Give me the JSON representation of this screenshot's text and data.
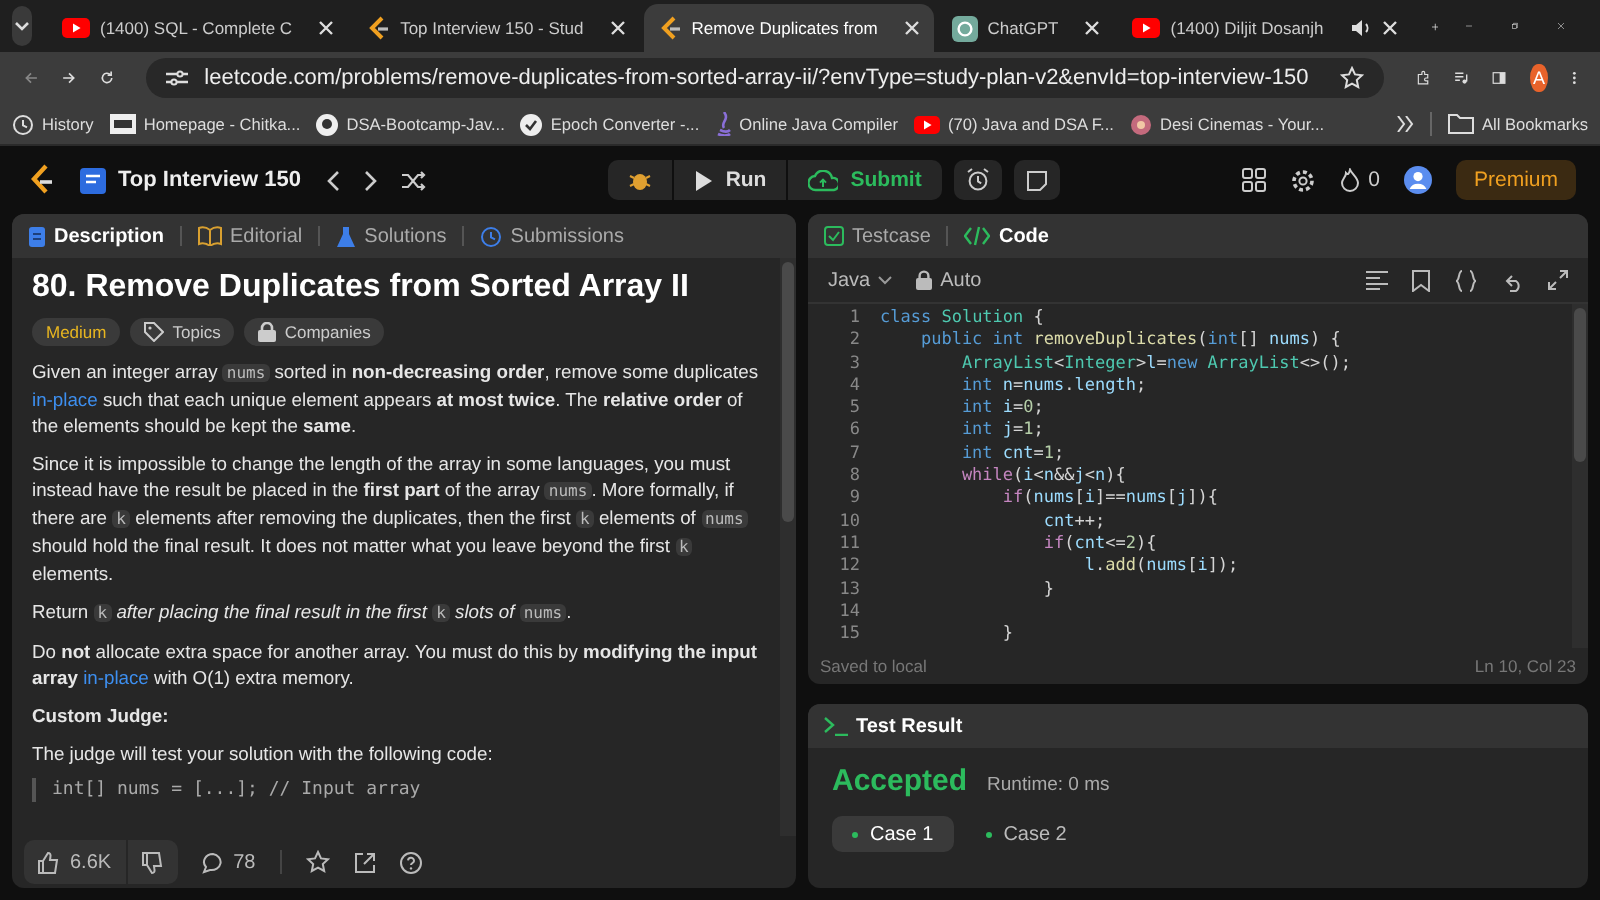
{
  "browser": {
    "tabs": [
      {
        "title": "(1400) SQL - Complete C",
        "kind": "video",
        "selected": false,
        "audio": false
      },
      {
        "title": "Top Interview 150 - Stud",
        "kind": "code",
        "selected": false,
        "audio": false
      },
      {
        "title": "Remove Duplicates from",
        "kind": "code",
        "selected": true,
        "audio": false
      },
      {
        "title": "ChatGPT",
        "kind": "chat",
        "selected": false,
        "audio": false
      },
      {
        "title": "(1400) Diljit Dosanjh",
        "kind": "video",
        "selected": false,
        "audio": true
      }
    ],
    "url": "leetcode.com/problems/remove-duplicates-from-sorted-array-ii/?envType=study-plan-v2&envId=top-interview-150",
    "profile_initial": "A",
    "bookmarks": [
      {
        "label": "History",
        "kind": "clock"
      },
      {
        "label": "Homepage - Chitka...",
        "kind": "site"
      },
      {
        "label": "DSA-Bootcamp-Jav...",
        "kind": "github"
      },
      {
        "label": "Epoch Converter -...",
        "kind": "circle"
      },
      {
        "label": "Online Java Compiler",
        "kind": "java"
      },
      {
        "label": "(70) Java and DSA F...",
        "kind": "video"
      },
      {
        "label": "Desi Cinemas - Your...",
        "kind": "site2"
      }
    ],
    "all_bookmarks": "All Bookmarks"
  },
  "nav": {
    "study_plan": "Top Interview 150",
    "run": "Run",
    "submit": "Submit",
    "streak": "0",
    "premium": "Premium"
  },
  "description": {
    "tabs": [
      {
        "label": "Description",
        "kind": "doc",
        "selected": true
      },
      {
        "label": "Editorial",
        "kind": "book",
        "selected": false
      },
      {
        "label": "Solutions",
        "kind": "flask",
        "selected": false
      },
      {
        "label": "Submissions",
        "kind": "clock",
        "selected": false
      }
    ],
    "title": "80. Remove Duplicates from Sorted Array II",
    "difficulty": "Medium",
    "topics": "Topics",
    "companies": "Companies",
    "paragraphs": [
      {
        "kind": "text",
        "parts": [
          {
            "kind": "text",
            "text": "Given an integer array "
          },
          {
            "kind": "code",
            "text": "nums"
          },
          {
            "kind": "text",
            "text": " sorted in **non-decreasing order**, remove some duplicates "
          },
          {
            "kind": "link",
            "text": "in-place"
          },
          {
            "kind": "text",
            "text": " such that each unique element appears **at most twice**. The **relative order** of the elements should be kept the **same**."
          }
        ]
      },
      {
        "kind": "text",
        "parts": [
          {
            "kind": "text",
            "text": "Since it is impossible to change the length of the array in some languages, you must instead have the result be placed in the **first part** of the array "
          },
          {
            "kind": "code",
            "text": "nums"
          },
          {
            "kind": "text",
            "text": ". More formally, if there are "
          },
          {
            "kind": "code",
            "text": "k"
          },
          {
            "kind": "text",
            "text": " elements after removing the duplicates, then the first "
          },
          {
            "kind": "code",
            "text": "k"
          },
          {
            "kind": "text",
            "text": " elements of "
          },
          {
            "kind": "code",
            "text": "nums"
          },
          {
            "kind": "text",
            "text": " should hold the final result. It does not matter what you leave beyond the first "
          },
          {
            "kind": "code",
            "text": "k"
          },
          {
            "kind": "text",
            "text": " elements."
          }
        ]
      },
      {
        "kind": "text",
        "parts": [
          {
            "kind": "text",
            "text": "Return "
          },
          {
            "kind": "code",
            "text": "k"
          },
          {
            "kind": "text",
            "text": " *after placing the final result in the first* "
          },
          {
            "kind": "code",
            "text": "k"
          },
          {
            "kind": "text",
            "text": " *slots of* "
          },
          {
            "kind": "code",
            "text": "nums"
          },
          {
            "kind": "text",
            "text": "."
          }
        ]
      },
      {
        "kind": "text",
        "parts": [
          {
            "kind": "text",
            "text": "Do **not** allocate extra space for another array. You must do this by **modifying the input array** "
          },
          {
            "kind": "link",
            "text": "in-place"
          },
          {
            "kind": "text",
            "text": " with O(1) extra memory."
          }
        ]
      },
      {
        "kind": "heading",
        "parts": [
          {
            "kind": "text",
            "text": "Custom Judge:"
          }
        ]
      },
      {
        "kind": "text",
        "parts": [
          {
            "kind": "text",
            "text": "The judge will test your solution with the following code:"
          }
        ]
      },
      {
        "kind": "codeblock",
        "parts": [
          {
            "kind": "text",
            "text": "int[] nums = [...]; // Input array"
          }
        ]
      }
    ],
    "likes": "6.6K",
    "comments": "78"
  },
  "editor": {
    "tabs": [
      {
        "label": "Testcase",
        "kind": "check",
        "selected": false
      },
      {
        "label": "Code",
        "kind": "code",
        "selected": true
      }
    ],
    "language": "Java",
    "mode": "Auto",
    "lines": [
      {
        "number": "1",
        "tokens": [
          {
            "kind": "keyword",
            "text": "class"
          },
          {
            "kind": "type",
            "text": " Solution"
          },
          {
            "kind": "plain",
            "text": " {"
          }
        ]
      },
      {
        "number": "2",
        "tokens": [
          {
            "kind": "keyword",
            "text": "    public"
          },
          {
            "kind": "keyword",
            "text": " int"
          },
          {
            "kind": "function",
            "text": " removeDuplicates"
          },
          {
            "kind": "plain",
            "text": "("
          },
          {
            "kind": "keyword",
            "text": "int"
          },
          {
            "kind": "plain",
            "text": "[] "
          },
          {
            "kind": "variable",
            "text": "nums"
          },
          {
            "kind": "plain",
            "text": ") {"
          }
        ]
      },
      {
        "number": "3",
        "tokens": [
          {
            "kind": "type",
            "text": "        ArrayList"
          },
          {
            "kind": "plain",
            "text": "<"
          },
          {
            "kind": "type",
            "text": "Integer"
          },
          {
            "kind": "plain",
            "text": ">"
          },
          {
            "kind": "variable",
            "text": "l"
          },
          {
            "kind": "plain",
            "text": "="
          },
          {
            "kind": "keyword",
            "text": "new"
          },
          {
            "kind": "type",
            "text": " ArrayList"
          },
          {
            "kind": "plain",
            "text": "<>();"
          }
        ]
      },
      {
        "number": "4",
        "tokens": [
          {
            "kind": "keyword",
            "text": "        int"
          },
          {
            "kind": "variable",
            "text": " n"
          },
          {
            "kind": "plain",
            "text": "="
          },
          {
            "kind": "variable",
            "text": "nums"
          },
          {
            "kind": "plain",
            "text": "."
          },
          {
            "kind": "variable",
            "text": "length"
          },
          {
            "kind": "plain",
            "text": ";"
          }
        ]
      },
      {
        "number": "5",
        "tokens": [
          {
            "kind": "keyword",
            "text": "        int"
          },
          {
            "kind": "variable",
            "text": " i"
          },
          {
            "kind": "plain",
            "text": "="
          },
          {
            "kind": "number",
            "text": "0"
          },
          {
            "kind": "plain",
            "text": ";"
          }
        ]
      },
      {
        "number": "6",
        "tokens": [
          {
            "kind": "keyword",
            "text": "        int"
          },
          {
            "kind": "variable",
            "text": " j"
          },
          {
            "kind": "plain",
            "text": "="
          },
          {
            "kind": "number",
            "text": "1"
          },
          {
            "kind": "plain",
            "text": ";"
          }
        ]
      },
      {
        "number": "7",
        "tokens": [
          {
            "kind": "keyword",
            "text": "        int"
          },
          {
            "kind": "variable",
            "text": " cnt"
          },
          {
            "kind": "plain",
            "text": "="
          },
          {
            "kind": "number",
            "text": "1"
          },
          {
            "kind": "plain",
            "text": ";"
          }
        ]
      },
      {
        "number": "8",
        "tokens": [
          {
            "kind": "control",
            "text": "        while"
          },
          {
            "kind": "plain",
            "text": "("
          },
          {
            "kind": "variable",
            "text": "i"
          },
          {
            "kind": "plain",
            "text": "<"
          },
          {
            "kind": "variable",
            "text": "n"
          },
          {
            "kind": "plain",
            "text": "&&"
          },
          {
            "kind": "variable",
            "text": "j"
          },
          {
            "kind": "plain",
            "text": "<"
          },
          {
            "kind": "variable",
            "text": "n"
          },
          {
            "kind": "plain",
            "text": "){"
          }
        ]
      },
      {
        "number": "9",
        "tokens": [
          {
            "kind": "control",
            "text": "            if"
          },
          {
            "kind": "plain",
            "text": "("
          },
          {
            "kind": "variable",
            "text": "nums"
          },
          {
            "kind": "plain",
            "text": "["
          },
          {
            "kind": "variable",
            "text": "i"
          },
          {
            "kind": "plain",
            "text": "]=="
          },
          {
            "kind": "variable",
            "text": "nums"
          },
          {
            "kind": "plain",
            "text": "["
          },
          {
            "kind": "variable",
            "text": "j"
          },
          {
            "kind": "plain",
            "text": "]){"
          }
        ]
      },
      {
        "number": "10",
        "tokens": [
          {
            "kind": "variable",
            "text": "                cnt"
          },
          {
            "kind": "plain",
            "text": "++;"
          }
        ]
      },
      {
        "number": "11",
        "tokens": [
          {
            "kind": "control",
            "text": "                if"
          },
          {
            "kind": "plain",
            "text": "("
          },
          {
            "kind": "variable",
            "text": "cnt"
          },
          {
            "kind": "plain",
            "text": "<="
          },
          {
            "kind": "number",
            "text": "2"
          },
          {
            "kind": "plain",
            "text": "){"
          }
        ]
      },
      {
        "number": "12",
        "tokens": [
          {
            "kind": "variable",
            "text": "                    l"
          },
          {
            "kind": "plain",
            "text": "."
          },
          {
            "kind": "function",
            "text": "add"
          },
          {
            "kind": "plain",
            "text": "("
          },
          {
            "kind": "variable",
            "text": "nums"
          },
          {
            "kind": "plain",
            "text": "["
          },
          {
            "kind": "variable",
            "text": "i"
          },
          {
            "kind": "plain",
            "text": "]);"
          }
        ]
      },
      {
        "number": "13",
        "tokens": [
          {
            "kind": "plain",
            "text": "                }"
          }
        ]
      },
      {
        "number": "14"
      },
      {
        "number": "15",
        "tokens": [
          {
            "kind": "plain",
            "text": "            }"
          }
        ]
      }
    ],
    "saved": "Saved to local",
    "cursor": "Ln 10, Col 23"
  },
  "result": {
    "title": "Test Result",
    "verdict": "Accepted",
    "runtime": "Runtime: 0 ms",
    "cases": [
      {
        "label": "Case 1",
        "selected": true
      },
      {
        "label": "Case 2",
        "selected": false
      }
    ]
  }
}
